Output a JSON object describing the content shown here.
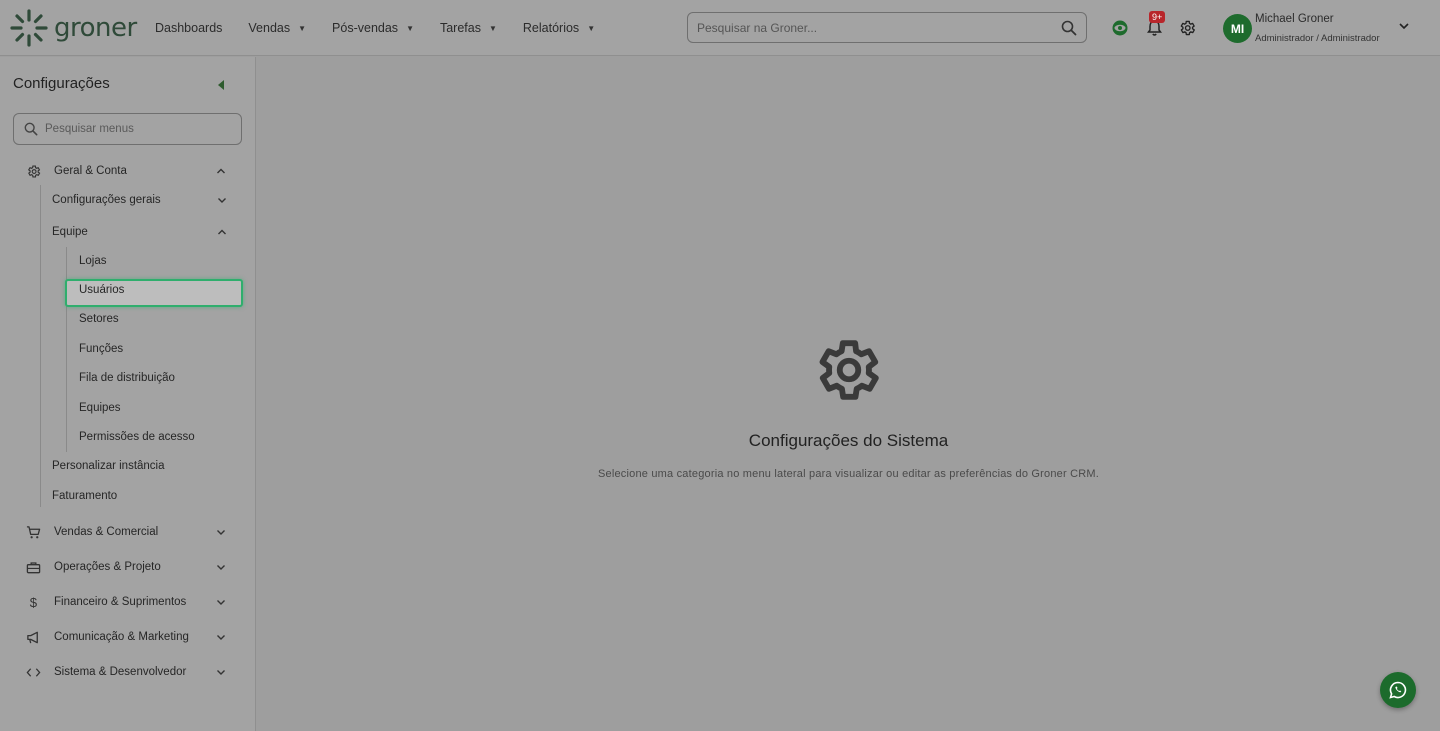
{
  "brand": {
    "name": "groner",
    "color": "#2f4a39"
  },
  "nav": [
    {
      "label": "Dashboards",
      "dropdown": false
    },
    {
      "label": "Vendas",
      "dropdown": true
    },
    {
      "label": "Pós-vendas",
      "dropdown": true
    },
    {
      "label": "Tarefas",
      "dropdown": true
    },
    {
      "label": "Relatórios",
      "dropdown": true
    }
  ],
  "search": {
    "placeholder": "Pesquisar na Groner..."
  },
  "notifications": {
    "badge": "9+"
  },
  "user": {
    "initials": "MI",
    "name": "Michael Groner",
    "role": "Administrador / Administrador"
  },
  "sidebar": {
    "title": "Configurações",
    "search_placeholder": "Pesquisar menus",
    "groups": [
      {
        "label": "Geral & Conta",
        "icon": "gear-icon",
        "expanded": true
      },
      {
        "label": "Vendas & Comercial",
        "icon": "cart-icon",
        "expanded": false
      },
      {
        "label": "Operações & Projeto",
        "icon": "toolbox-icon",
        "expanded": false
      },
      {
        "label": "Financeiro & Suprimentos",
        "icon": "dollar-icon",
        "expanded": false
      },
      {
        "label": "Comunicação & Marketing",
        "icon": "megaphone-icon",
        "expanded": false
      },
      {
        "label": "Sistema & Desenvolvedor",
        "icon": "code-icon",
        "expanded": false
      }
    ],
    "geral": {
      "configuracoes_gerais": "Configurações gerais",
      "equipe": "Equipe",
      "equipe_items": [
        "Lojas",
        "Usuários",
        "Setores",
        "Funções",
        "Fila de distribuição",
        "Equipes",
        "Permissões de acesso"
      ],
      "personalizar": "Personalizar instância",
      "faturamento": "Faturamento"
    },
    "active_item": "Usuários"
  },
  "main": {
    "title": "Configurações do Sistema",
    "subtitle": "Selecione uma categoria no menu lateral para visualizar ou editar as preferências do Groner CRM."
  },
  "colors": {
    "accent": "#1e6b2d",
    "active_border": "#2fae6d",
    "badge": "#b8262b"
  }
}
